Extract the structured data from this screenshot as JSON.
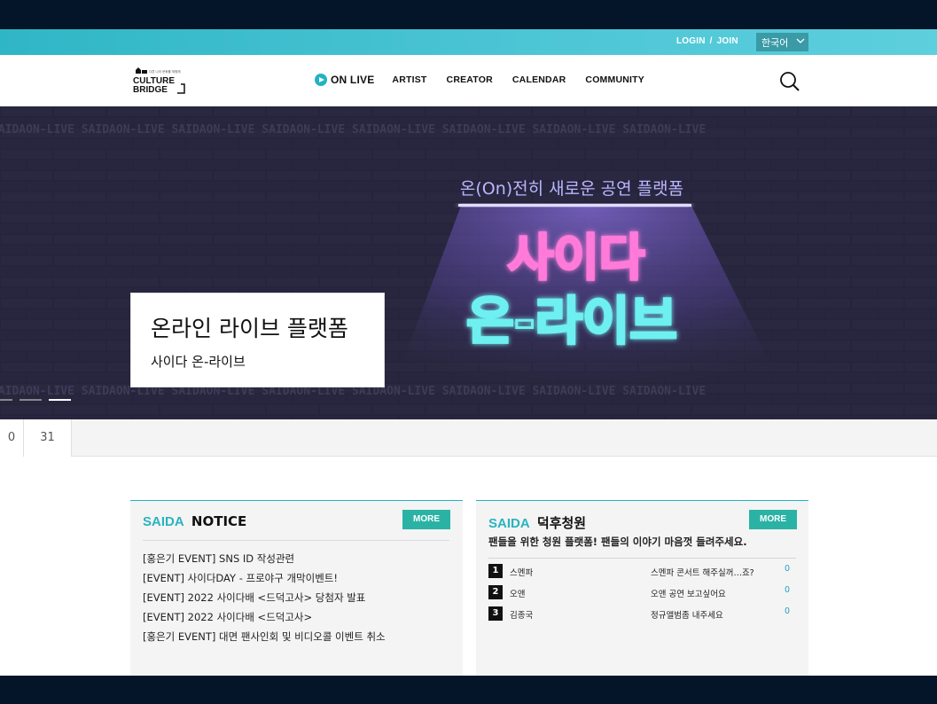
{
  "topbar": {
    "login": "LOGIN",
    "separator": "/",
    "join": "JOIN",
    "language": "한국어"
  },
  "logo": {
    "line1": "CULTURE",
    "line2": "BRIDGE",
    "tagline": "다른 나라 문화를 체험해"
  },
  "nav": {
    "onlive": "ON LIVE",
    "artist": "ARTIST",
    "creator": "CREATOR",
    "calendar": "CALENDAR",
    "community": "COMMUNITY"
  },
  "hero": {
    "tagline": "온(On)전히 새로운 공연 플랫폼",
    "neon_line1": "사이다",
    "neon_line2": "온-라이브",
    "watermark": "SAIDAON-LIVE SAIDAON-LIVE SAIDAON-LIVE SAIDAON-LIVE SAIDAON-LIVE SAIDAON-LIVE SAIDAON-LIVE SAIDAON-LIVE",
    "caption_title": "온라인 라이브 플랫폼",
    "caption_sub": "사이다 온-라이브"
  },
  "datebar": {
    "dates": [
      "0",
      "31"
    ]
  },
  "notice": {
    "brand": "SAIDA",
    "title": "NOTICE",
    "more": "MORE",
    "items": [
      "[홍은기 EVENT] SNS ID 작성관련",
      "[EVENT] 사이다DAY - 프로야구 개막이벤트!",
      "[EVENT] 2022 사이다배 <드덕고사> 당첨자 발표",
      "[EVENT] 2022 사이다배 <드덕고사>",
      "[홍은기 EVENT] 대면 팬사인회 및 비디오콜 이벤트 취소"
    ]
  },
  "petition": {
    "brand": "SAIDA",
    "title": "덕후청원",
    "more": "MORE",
    "subtitle": "팬들을 위한 청원 플랫폼! 팬들의 이야기 마음껏 들려주세요.",
    "rows": [
      {
        "rank": "1",
        "name": "스멘파",
        "title": "스멘파 콘서트 해주실꺼…죠?",
        "count": "0"
      },
      {
        "rank": "2",
        "name": "오앤",
        "title": "오앤 공연 보고싶어요",
        "count": "0"
      },
      {
        "rank": "3",
        "name": "김종국",
        "title": "정규앨범좀 내주세요",
        "count": "0"
      }
    ]
  },
  "colors": {
    "accent": "#2ab3c0",
    "button": "#2ab3a5",
    "background": "#04152a"
  }
}
